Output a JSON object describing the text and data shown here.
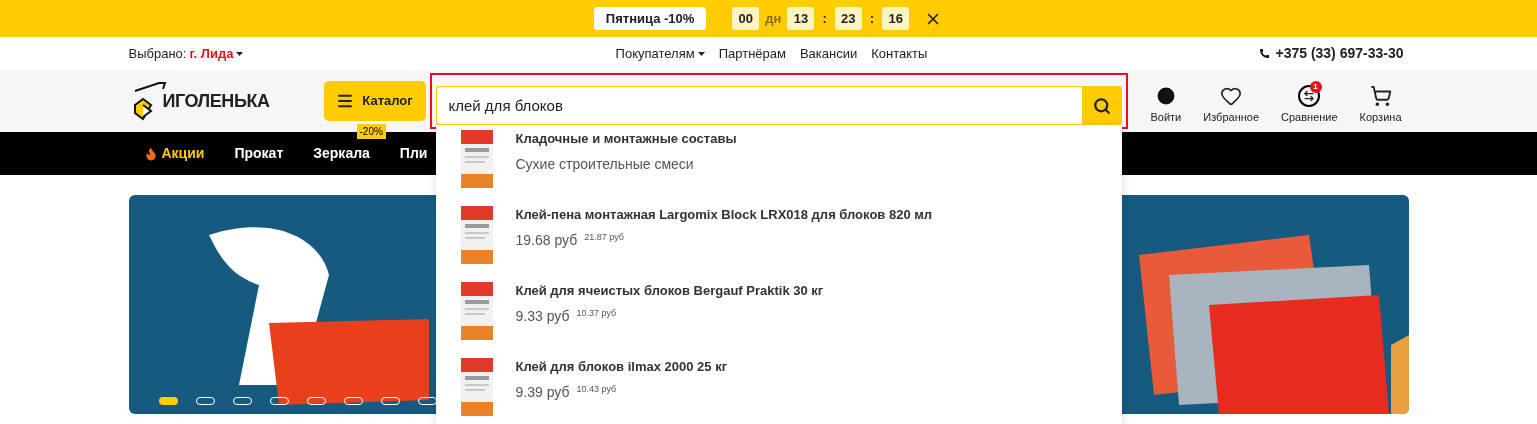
{
  "promo_bar": {
    "label": "Пятница -10%",
    "countdown": [
      {
        "kind": "value",
        "text": "00"
      },
      {
        "kind": "unit",
        "text": "дн"
      },
      {
        "kind": "value",
        "text": "13"
      },
      {
        "kind": "sep",
        "text": ":"
      },
      {
        "kind": "value",
        "text": "23"
      },
      {
        "kind": "sep",
        "text": ":"
      },
      {
        "kind": "value",
        "text": "16"
      }
    ]
  },
  "top_links": {
    "city_label": "Выбрано:",
    "city": "г. Лида",
    "menu": [
      {
        "label": "Покупателям",
        "dropdown": true
      },
      {
        "label": "Партнёрам",
        "dropdown": false
      },
      {
        "label": "Вакансии",
        "dropdown": false
      },
      {
        "label": "Контакты",
        "dropdown": false
      }
    ],
    "phone": "+375 (33) 697-33-30"
  },
  "header": {
    "logo": "ИГОЛЕНЬКА",
    "catalog_button": "Каталог",
    "search": {
      "value": "клей для блоков"
    },
    "actions": [
      {
        "kind": "account",
        "label": "Войти"
      },
      {
        "kind": "favorites",
        "label": "Избранное"
      },
      {
        "kind": "compare",
        "label": "Сравнение",
        "badge": "1"
      },
      {
        "kind": "cart",
        "label": "Корзина"
      }
    ]
  },
  "nav": [
    {
      "kind": "promo",
      "label": "Акции"
    },
    {
      "kind": "plain",
      "label": "Прокат"
    },
    {
      "kind": "plain",
      "label": "Зеркала",
      "badge": "-20%"
    },
    {
      "kind": "plain",
      "label": "Пли"
    }
  ],
  "suggestions": [
    {
      "kind": "category",
      "title": "Кладочные и монтажные составы",
      "subtitle": "Сухие строительные смеси"
    },
    {
      "kind": "product",
      "title": "Клей-пена монтажная Largomix Block LRX018 для блоков 820 мл",
      "price": "19.68 руб",
      "old_price": "21.87 руб"
    },
    {
      "kind": "product",
      "title": "Клей для ячеистых блоков Bergauf Praktik 30 кг",
      "price": "9.33 руб",
      "old_price": "10.37 руб"
    },
    {
      "kind": "product",
      "title": "Клей для блоков ilmax 2000 25 кг",
      "price": "9.39 руб",
      "old_price": "10.43 руб"
    }
  ],
  "banner": {
    "dots": [
      {
        "selected": true
      },
      {
        "selected": false
      },
      {
        "selected": false
      },
      {
        "selected": false
      },
      {
        "selected": false
      },
      {
        "selected": false
      },
      {
        "selected": false
      },
      {
        "selected": false
      }
    ]
  }
}
